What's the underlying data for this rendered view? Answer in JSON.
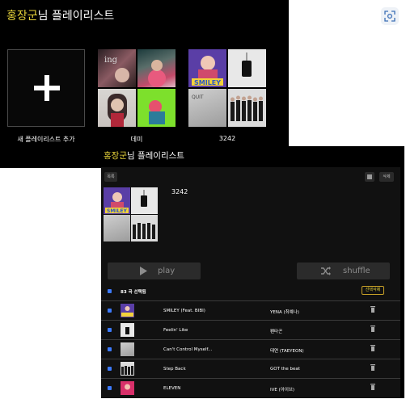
{
  "top": {
    "title_highlight": "홍장군",
    "title_rest": "님 플레이리스트",
    "add_label": "새 플레이리스트 추가",
    "playlists": [
      {
        "name": "데미"
      },
      {
        "name": "3242"
      }
    ]
  },
  "bottom": {
    "title_highlight": "홍장군",
    "title_rest": "님 플레이리스트",
    "back_label": "목록",
    "delete_label": "삭제",
    "playlist_name": "3242",
    "play_label": "play",
    "shuffle_label": "shuffle",
    "count_label": "83 곡 선택됨",
    "delete_selected_label": "선택삭제",
    "songs": [
      {
        "title": "SMILEY (Feat. BIBI)",
        "artist": "YENA (최예나)"
      },
      {
        "title": "Feelin' Like",
        "artist": "펜타곤"
      },
      {
        "title": "Can't Control Myself...",
        "artist": "태연 (TAEYEON)"
      },
      {
        "title": "Step Back",
        "artist": "GOT the beat"
      },
      {
        "title": "ELEVEN",
        "artist": "IVE (아이브)"
      }
    ]
  },
  "icons": {
    "screenshot": "screenshot-icon",
    "plus": "plus-icon",
    "play": "play-icon",
    "shuffle": "shuffle-icon",
    "trash": "trash-icon",
    "save": "save-icon"
  },
  "colors": {
    "highlight": "#e6d23a",
    "checkbox": "#3d7bff",
    "delete_selected_border": "#c9a227"
  }
}
